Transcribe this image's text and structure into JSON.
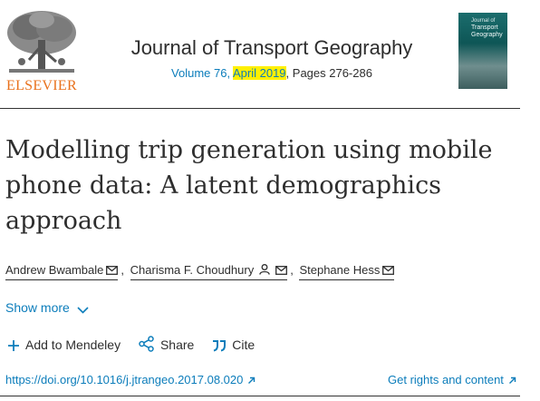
{
  "publisher": {
    "logo_word": "ELSEVIER",
    "logo_icon": "elsevier-tree-icon",
    "accent_color": "#e9711c"
  },
  "journal": {
    "title": "Journal of Transport Geography",
    "volume_link": "Volume 76",
    "date_highlighted": "April 2019",
    "pages": ", Pages 276-286",
    "cover_small": "Journal of",
    "cover_title": "Transport Geography",
    "highlight_color": "#fff000",
    "link_color": "#0c7dbb"
  },
  "article": {
    "title": "Modelling trip generation using mobile phone data: A latent demographics approach"
  },
  "authors": [
    {
      "name": "Andrew Bwambale",
      "icons": [
        "envelope-icon"
      ]
    },
    {
      "name": "Charisma F. Choudhury",
      "icons": [
        "person-icon",
        "envelope-icon"
      ]
    },
    {
      "name": "Stephane Hess",
      "icons": [
        "envelope-icon"
      ]
    }
  ],
  "author_separator": ",",
  "show_more": {
    "label": "Show more",
    "icon": "chevron-down-icon"
  },
  "actions": [
    {
      "label": "Add to Mendeley",
      "icon": "plus-icon"
    },
    {
      "label": "Share",
      "icon": "share-icon"
    },
    {
      "label": "Cite",
      "icon": "quote-icon"
    }
  ],
  "links": {
    "doi": "https://doi.org/10.1016/j.jtrangeo.2017.08.020",
    "rights": "Get rights and content"
  }
}
